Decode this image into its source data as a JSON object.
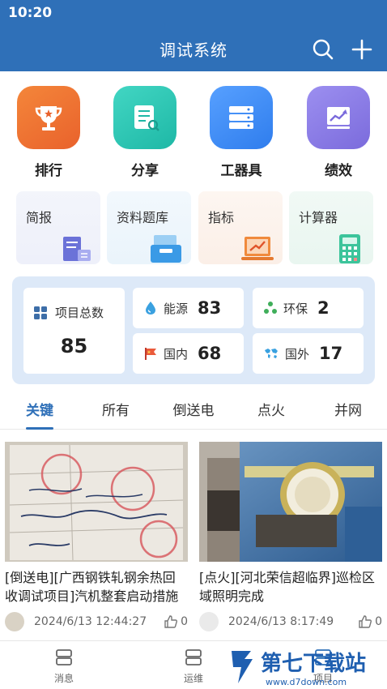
{
  "status_bar": {
    "time": "10:20"
  },
  "header": {
    "title": "调试系统"
  },
  "shortcuts": [
    {
      "label": "排行",
      "icon": "trophy-icon"
    },
    {
      "label": "分享",
      "icon": "document-share-icon"
    },
    {
      "label": "工器具",
      "icon": "server-rack-icon"
    },
    {
      "label": "绩效",
      "icon": "performance-chart-icon"
    }
  ],
  "quick_cards": [
    {
      "label": "简报",
      "icon": "briefing-icon"
    },
    {
      "label": "资料题库",
      "icon": "file-tray-icon"
    },
    {
      "label": "指标",
      "icon": "trend-laptop-icon"
    },
    {
      "label": "计算器",
      "icon": "calculator-icon"
    }
  ],
  "stats": {
    "total": {
      "label": "项目总数",
      "value": "85"
    },
    "items": [
      {
        "label": "能源",
        "value": "83",
        "icon": "drop-icon"
      },
      {
        "label": "环保",
        "value": "2",
        "icon": "recycle-icon"
      },
      {
        "label": "国内",
        "value": "68",
        "icon": "flag-icon"
      },
      {
        "label": "国外",
        "value": "17",
        "icon": "world-map-icon"
      }
    ]
  },
  "tabs": [
    "关键",
    "所有",
    "倒送电",
    "点火",
    "并网"
  ],
  "active_tab": "关键",
  "articles": [
    {
      "title": "[倒送电][广西钢铁轧钢余热回收调试项目]汽机整套启动措施",
      "date": "2024/6/13 12:44:27",
      "likes": "0"
    },
    {
      "title": "[点火][河北荣信超临界]巡检区域照明完成",
      "date": "2024/6/13 8:17:49",
      "likes": "0"
    }
  ],
  "bottom_nav": [
    {
      "label": "消息",
      "icon": "message-icon"
    },
    {
      "label": "运维",
      "icon": "maintenance-icon"
    },
    {
      "label": "项目",
      "icon": "project-icon"
    }
  ],
  "watermark": {
    "text": "第七下载站",
    "url_text": "www.d7down.com"
  },
  "colors": {
    "primary": "#2f70b8",
    "panel": "#dde9f8"
  }
}
